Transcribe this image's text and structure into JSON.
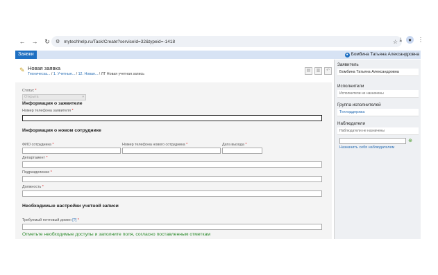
{
  "browser": {
    "url": "mytechhelp.ru/Task/Create?serviceId=32&typeid=-1418",
    "back_icon": "←",
    "forward_icon": "→",
    "reload_icon": "↻",
    "tune_icon": "⚙",
    "star_icon": "☆",
    "download_icon": "⤓",
    "menu_icon": "⋮",
    "profile_icon": "●"
  },
  "header": {
    "tab_label": "Заявки",
    "user_name": "Бомбина Татьяна Александровна"
  },
  "request": {
    "title": "Новая заявка",
    "crumb_1": "Техническа...",
    "crumb_2": "1. Учетные...",
    "crumb_3": "12. Новая...",
    "crumb_4": "ЛТ Новая учетная запись",
    "sep": " / ",
    "pencil_icon": "✎",
    "tool_icons": [
      "▤",
      "▥",
      "↶"
    ]
  },
  "form": {
    "status_label": "Статус",
    "status_value": "Открыта",
    "section_applicant": "Информация о заявителе",
    "applicant_phone_label": "Номер телефона заявителя",
    "section_employee": "Информация о новом сотруднике",
    "fio_label": "ФИО сотрудника",
    "new_phone_label": "Номер телефона нового сотрудника",
    "exit_date_label": "Дата выхода",
    "department_label": "Департамент",
    "division_label": "Подразделение",
    "position_label": "Должность",
    "section_settings": "Необходимые настройки учетной записи",
    "mail_domain_label": "Требуемый почтовый домен",
    "mail_domain_hint": "[?]",
    "note": "Отметьте необходимые доступы и заполните поля, согласно поставленным отметкам",
    "required_mark": "*"
  },
  "panel": {
    "requester_header": "Заявитель",
    "requester_value": "Бомбина Татьяна Александровна",
    "executors_header": "Исполнители",
    "executors_value": "Исполнители не назначены",
    "group_header": "Группа исполнителей",
    "group_value": "Техподдержка",
    "observers_header": "Наблюдатели",
    "observers_value": "Наблюдатели не назначены",
    "assign_self_link": "Назначить себя наблюдателем",
    "add_icon": "⊕"
  }
}
